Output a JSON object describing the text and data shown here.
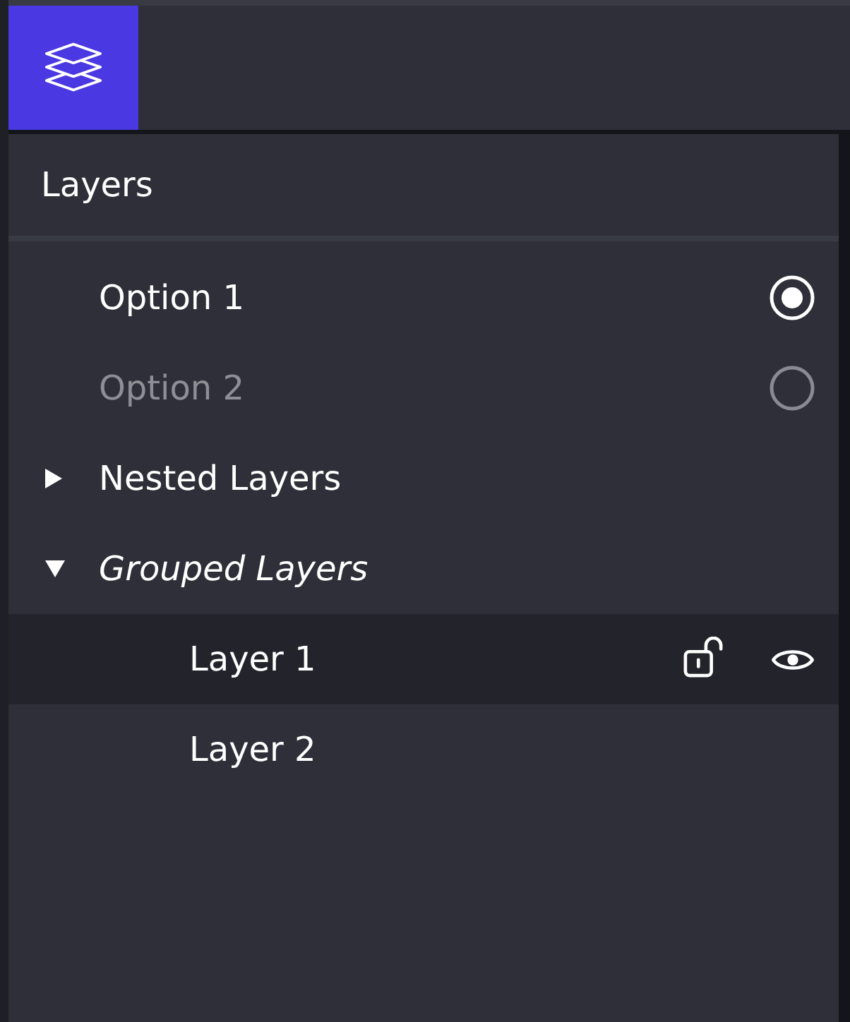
{
  "toolbar": {
    "layers_button": {
      "selected": true
    }
  },
  "panel": {
    "title": "Layers",
    "items": [
      {
        "kind": "radio",
        "label": "Option 1",
        "selected": true,
        "disabled": false
      },
      {
        "kind": "radio",
        "label": "Option 2",
        "selected": false,
        "disabled": true
      },
      {
        "kind": "nested",
        "label": "Nested Layers",
        "expanded": false
      },
      {
        "kind": "group",
        "label": "Grouped Layers",
        "expanded": true,
        "children": [
          {
            "kind": "layer",
            "label": "Layer 1",
            "selected": true,
            "locked": false,
            "visible": true
          },
          {
            "kind": "layer",
            "label": "Layer 2",
            "selected": false
          }
        ]
      }
    ]
  }
}
